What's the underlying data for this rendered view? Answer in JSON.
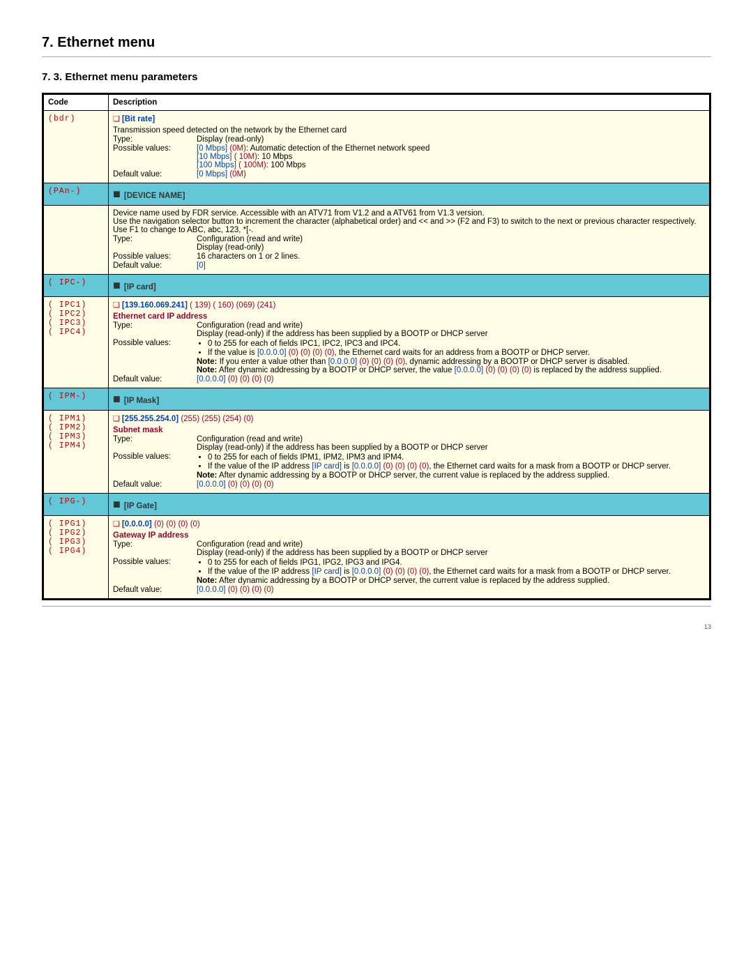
{
  "page_title": "7. Ethernet menu",
  "section_title": "7. 3. Ethernet menu parameters",
  "page_number": "13",
  "hdr": {
    "code": "Code",
    "desc": "Description"
  },
  "bdr": {
    "code": "(bdr)",
    "name": "[Bit rate]",
    "intro": "Transmission speed detected on the network by the Ethernet card",
    "type_label": "Type:",
    "type_val": "Display (read-only)",
    "pv_label": "Possible values:",
    "pv1a": "[0 Mbps]",
    "pv1b": "(0M)",
    "pv1c": ": Automatic detection of the Ethernet network speed",
    "pv2a": "[10 Mbps]",
    "pv2b": "( 10M)",
    "pv2c": ": 10 Mbps",
    "pv3a": "[100 Mbps]",
    "pv3b": "( 100M)",
    "pv3c": ": 100 Mbps",
    "dv_label": "Default value:",
    "dv_a": "[0 Mbps]",
    "dv_b": "(0M)"
  },
  "dev": {
    "code": "(PAn-)",
    "title": "[DEVICE NAME]",
    "d1": "Device name used by FDR service. Accessible with an ATV71 from V1.2 and a ATV61 from V1.3 version.",
    "d2": "Use the navigation selector button to increment the character (alphabetical order) and << and >> (F2 and F3) to switch to the next or previous character respectively. Use F1 to change to ABC, abc, 123, *[-.",
    "type_label": "Type:",
    "type1": "Configuration (read and write)",
    "type2": "Display (read-only)",
    "pv_label": "Possible values:",
    "pv": "16 characters on 1 or 2 lines.",
    "dv_label": "Default value:",
    "dv": "[0]"
  },
  "ipc": {
    "code": "( IPC-)",
    "title": "[IP card]",
    "subcodes": "( IPC1)\n( IPC2)\n( IPC3)\n( IPC4)",
    "addr": "[139.160.069.241]",
    "addr_c": "( 139) ( 160) (069) (241)",
    "sub": "Ethernet card IP address",
    "type_label": "Type:",
    "type1": "Configuration (read and write)",
    "type2": "Display (read-only) if the address has been supplied by a BOOTP or DHCP server",
    "pv_label": "Possible values:",
    "pv1": "0 to 255 for each of fields IPC1, IPC2, IPC3 and IPC4.",
    "pv2a": "If the value is ",
    "pv2b": "[0.0.0.0]",
    "pv2c": "(0) (0) (0) (0)",
    "pv2d": ", the Ethernet card waits for an address from a BOOTP or DHCP server.",
    "n1a": "Note:",
    "n1b": " If you enter a value other than ",
    "n1c": "[0.0.0.0]",
    "n1d": "(0) (0) (0) (0)",
    "n1e": ", dynamic addressing by a BOOTP or DHCP server is disabled.",
    "n2a": "Note:",
    "n2b": " After dynamic addressing by a BOOTP or DHCP server, the value ",
    "n2c": "[0.0.0.0]",
    "n2d": "(0) (0) (0) (0)",
    "n2e": " is replaced by the address supplied.",
    "dv_label": "Default value:",
    "dv_a": "[0.0.0.0]",
    "dv_b": "(0) (0) (0) (0)"
  },
  "ipm": {
    "code": "( IPM-)",
    "title": "[IP Mask]",
    "subcodes": "( IPM1)\n( IPM2)\n( IPM3)\n( IPM4)",
    "addr": "[255.255.254.0]",
    "addr_c": "(255) (255) (254) (0)",
    "sub": "Subnet mask",
    "type_label": "Type:",
    "type1": "Configuration (read and write)",
    "type2": "Display (read-only) if the address has been supplied by a BOOTP or DHCP server",
    "pv_label": "Possible values:",
    "pv1": "0 to 255 for each of fields IPM1, IPM2, IPM3 and IPM4.",
    "pv2a": "If the value of the IP address ",
    "pv2link": "[IP card]",
    "pv2b": " is ",
    "pv2c": "[0.0.0.0]",
    "pv2d": "(0) (0) (0) (0)",
    "pv2e": ", the Ethernet card waits for a mask from a BOOTP or DHCP server.",
    "na": "Note:",
    "nb": " After dynamic addressing by a BOOTP or DHCP server, the current value is replaced by the address supplied.",
    "dv_label": "Default value:",
    "dv_a": "[0.0.0.0]",
    "dv_b": "(0) (0) (0) (0)"
  },
  "ipg": {
    "code": "( IPG-)",
    "title": "[IP Gate]",
    "subcodes": "( IPG1)\n( IPG2)\n( IPG3)\n( IPG4)",
    "addr": "[0.0.0.0]",
    "addr_c": "(0) (0) (0) (0)",
    "sub": "Gateway IP address",
    "type_label": "Type:",
    "type1": "Configuration (read and write)",
    "type2": "Display (read-only) if the address has been supplied by a BOOTP or DHCP server",
    "pv_label": "Possible values:",
    "pv1": "0 to 255 for each of fields IPG1, IPG2, IPG3 and IPG4.",
    "pv2a": "If the value of the IP address ",
    "pv2link": "[IP card]",
    "pv2b": " is ",
    "pv2c": "[0.0.0.0]",
    "pv2d": "(0) (0) (0) (0)",
    "pv2e": ", the Ethernet card waits for a mask from a BOOTP or DHCP server.",
    "na": "Note:",
    "nb": " After dynamic addressing by a BOOTP or DHCP server, the current value is replaced by the address supplied.",
    "dv_label": "Default value:",
    "dv_a": "[0.0.0.0]",
    "dv_b": "(0) (0) (0) (0)"
  }
}
